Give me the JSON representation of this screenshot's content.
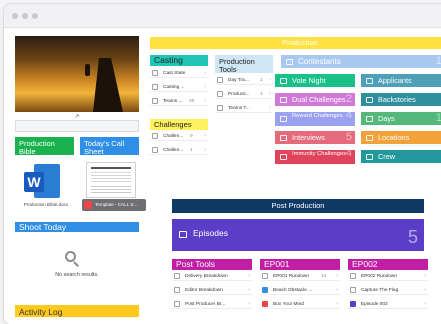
{
  "left": {
    "resource_list": "Resource List",
    "production_bible": {
      "title": "Production Bible",
      "file": "Production Bible.docx"
    },
    "call_sheet": {
      "title": "Today's Call Sheet",
      "file": "Template - CALL S..."
    },
    "shoot_today": {
      "title": "Shoot Today",
      "empty": "No search results."
    },
    "activity_log": "Activity Log"
  },
  "production": {
    "title": "Production",
    "casting": {
      "title": "Casting",
      "items": [
        "Cast State",
        "Casting ...",
        "Teams ..."
      ],
      "counts": [
        "",
        "",
        "20"
      ]
    },
    "production_tools": {
      "title": "Production Tools",
      "items": [
        "Day Tra...",
        "Producti...",
        "Teams T..."
      ],
      "counts": [
        "1",
        "1",
        ""
      ]
    },
    "challenges": {
      "title": "Challenges",
      "items": [
        "Challen...",
        "Challen..."
      ],
      "counts": [
        "9",
        "1"
      ]
    },
    "contestants": {
      "title": "Contestants",
      "count": "18"
    },
    "tiles": [
      {
        "label": "Vote Night",
        "count": "",
        "color": "#19c08a"
      },
      {
        "label": "Applicants",
        "count": "7",
        "color": "#4e9fb8"
      },
      {
        "label": "Dual Challenges",
        "count": "2",
        "color": "#d07ad8"
      },
      {
        "label": "Backstories",
        "count": "4",
        "color": "#2f8f9d"
      },
      {
        "label": "Reward Challenges",
        "count": "4",
        "color": "#9aa1f0"
      },
      {
        "label": "Days",
        "count": "10",
        "color": "#53b87a"
      },
      {
        "label": "Interviews",
        "count": "5",
        "color": "#e56a7b"
      },
      {
        "label": "Locations",
        "count": "2",
        "color": "#f2a23a"
      },
      {
        "label": "Immunity Challenges",
        "count": "4",
        "color": "#e0445c"
      },
      {
        "label": "Crew",
        "count": "7",
        "color": "#23989c"
      }
    ]
  },
  "post_production": {
    "title": "Post Production",
    "episodes": {
      "label": "Episodes",
      "count": "5"
    },
    "post_tools": {
      "title": "Post Tools",
      "items": [
        "Delivery Breakdown",
        "Editor Breakdown",
        "Post Producer Br..."
      ]
    },
    "ep001": {
      "title": "EP001",
      "items": [
        "EP001 Rundown",
        "Beach Obstacle ...",
        "Box Your Mind"
      ],
      "counts": [
        "14",
        "",
        ""
      ]
    },
    "ep002": {
      "title": "EP002",
      "items": [
        "EP002 Rundown",
        "Capture The Flag",
        "Episode 002"
      ]
    }
  }
}
